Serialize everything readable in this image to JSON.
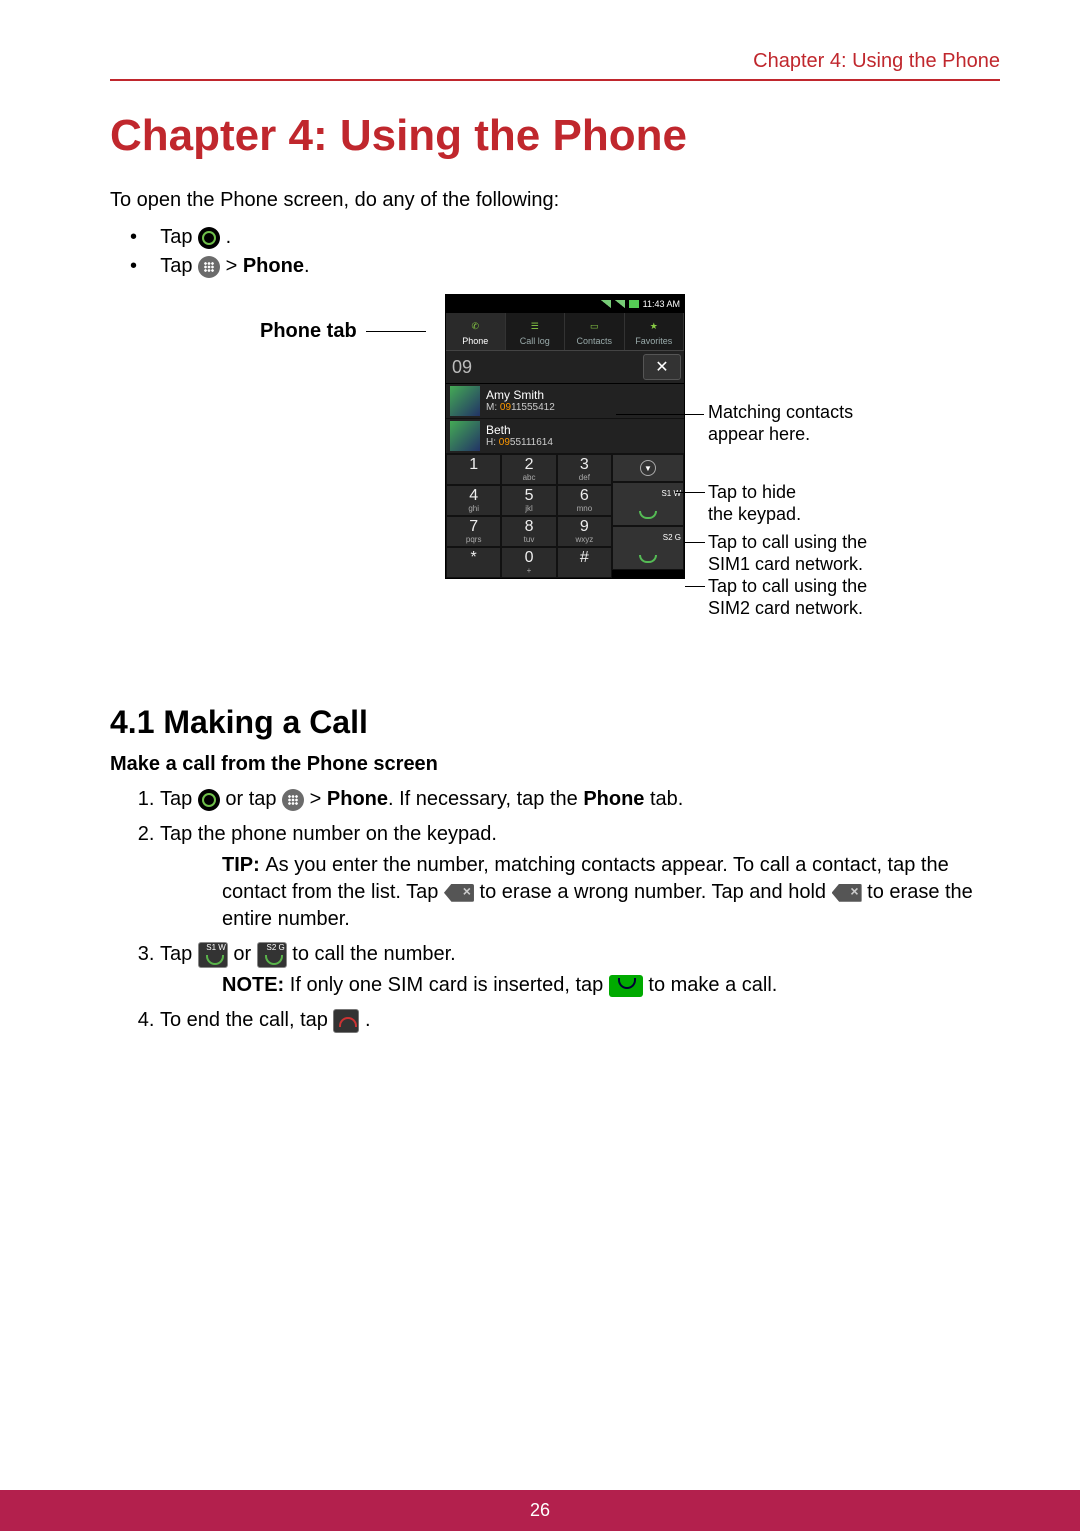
{
  "header": {
    "right": "Chapter 4: Using the Phone"
  },
  "chapter_title": "Chapter 4: Using the Phone",
  "intro": "To open the Phone screen, do any of the following:",
  "bullet1_a": "Tap ",
  "bullet2_a": "Tap ",
  "bullet2_b": "  > ",
  "bullet2_c": "Phone",
  "phonetab_label": "Phone tab",
  "callouts": {
    "c1a": "Matching contacts",
    "c1b": "appear here.",
    "c2a": "Tap to hide",
    "c2b": "the keypad.",
    "c3a": "Tap to call using the",
    "c3b": "SIM1 card network.",
    "c4a": "Tap to call using the",
    "c4b": "SIM2 card network."
  },
  "device": {
    "time": "11:43 AM",
    "tabs": {
      "phone": "Phone",
      "calllog": "Call log",
      "contacts": "Contacts",
      "favorites": "Favorites"
    },
    "entered": "09",
    "contact1": {
      "name": "Amy Smith",
      "prefix": "M: ",
      "hl": "09",
      "rest": "11555412"
    },
    "contact2": {
      "name": "Beth",
      "prefix": "H: ",
      "hl": "09",
      "rest": "55111614"
    },
    "keys": {
      "k1": "1",
      "k2": "2",
      "k2l": "abc",
      "k3": "3",
      "k3l": "def",
      "k4": "4",
      "k4l": "ghi",
      "k5": "5",
      "k5l": "jkl",
      "k6": "6",
      "k6l": "mno",
      "k7": "7",
      "k7l": "pqrs",
      "k8": "8",
      "k8l": "tuv",
      "k9": "9",
      "k9l": "wxyz",
      "ks": "*",
      "k0": "0",
      "k0l": "+",
      "kh": "#",
      "s1": "S1 W",
      "s2": "S2 G"
    }
  },
  "section_41": "4.1 Making a Call",
  "subtitle_make": "Make a call from the Phone screen",
  "step1_a": "Tap ",
  "step1_b": " or tap ",
  "step1_c": "  > ",
  "step1_d": "Phone",
  "step1_e": ". If necessary, tap the ",
  "step1_f": "Phone",
  "step1_g": " tab.",
  "step2": "Tap the phone number on the keypad.",
  "tip_label": "TIP: ",
  "tip_a": "As you enter the number, matching contacts appear. To call a contact, tap the contact from the list. Tap ",
  "tip_b": " to erase a wrong number. Tap and hold ",
  "tip_c": " to erase the entire number.",
  "step3_a": "Tap ",
  "step3_b": " or ",
  "step3_c": " to call the number.",
  "note_label": "NOTE: ",
  "note_a": "If only one SIM card is inserted, tap ",
  "note_b": " to make a call.",
  "step4_a": "To end the call, tap ",
  "step4_b": ".",
  "page_number": "26",
  "sim_labels": {
    "s1w": "S1 W",
    "s2g": "S2 G"
  }
}
